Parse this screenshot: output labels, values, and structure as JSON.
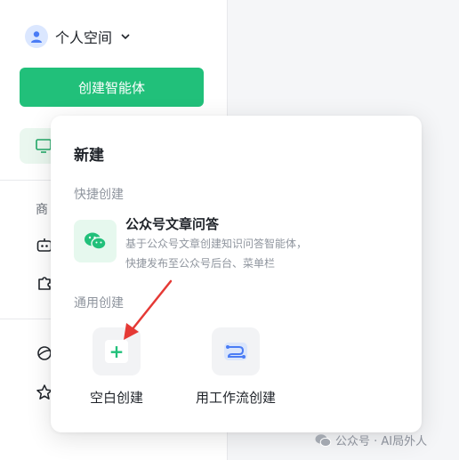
{
  "sidebar": {
    "space_label": "个人空间",
    "create_button_label": "创建智能体",
    "section_label_partial": "商"
  },
  "popover": {
    "title": "新建",
    "quick_group_label": "快捷创建",
    "quick_item": {
      "name": "公众号文章问答",
      "desc_line1": "基于公众号文章创建知识问答智能体，",
      "desc_line2": "快捷发布至公众号后台、菜单栏"
    },
    "general_group_label": "通用创建",
    "options": [
      {
        "label": "空白创建",
        "icon": "plus-icon"
      },
      {
        "label": "用工作流创建",
        "icon": "workflow-icon"
      }
    ]
  },
  "watermark": {
    "text": "公众号 · AI局外人"
  },
  "colors": {
    "accent": "#21c07a",
    "arrow": "#e53935"
  }
}
